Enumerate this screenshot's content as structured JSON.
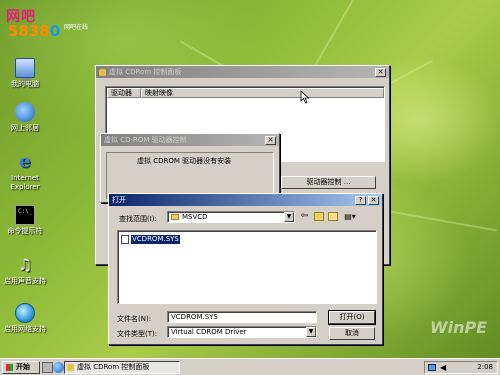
{
  "logo": {
    "text": "网吧",
    "num": "5838",
    "num_hl": "0",
    "sub": "网吧在线"
  },
  "desktop_icons": [
    {
      "label": "我的电脑",
      "icon": "computer-icon"
    },
    {
      "label": "网上邻居",
      "icon": "network-icon"
    },
    {
      "label": "Internet Explorer",
      "icon": "ie-icon"
    },
    {
      "label": "命令提示符",
      "icon": "cmd-icon"
    },
    {
      "label": "启用声音支持",
      "icon": "sound-icon"
    },
    {
      "label": "启用网络支持",
      "icon": "globe-icon"
    }
  ],
  "cdrom_panel": {
    "title": "虚拟 CDRom 控制面板",
    "col_drive": "驱动器",
    "col_image": "映射映像",
    "driver_button": "驱动器控制 ..."
  },
  "driver_dialog": {
    "title": "虚拟 CD-ROM 驱动器控制",
    "message": "虚拟 CDROM 驱动器没有安装"
  },
  "open_dialog": {
    "title": "打开",
    "help": "?",
    "lookin_label": "查找范围(I):",
    "lookin_value": "MSVCD",
    "files": [
      "VCDROM.SYS"
    ],
    "filename_label": "文件名(N):",
    "filename_value": "VCDROM.SYS",
    "filetype_label": "文件类型(T):",
    "filetype_value": "Virtual CDROM Driver",
    "open_button": "打开(O)",
    "cancel_button": "取消"
  },
  "watermark": "WinPE",
  "taskbar": {
    "start": "开始",
    "task": "虚拟 CDRom 控制面板",
    "clock": "2:08"
  }
}
